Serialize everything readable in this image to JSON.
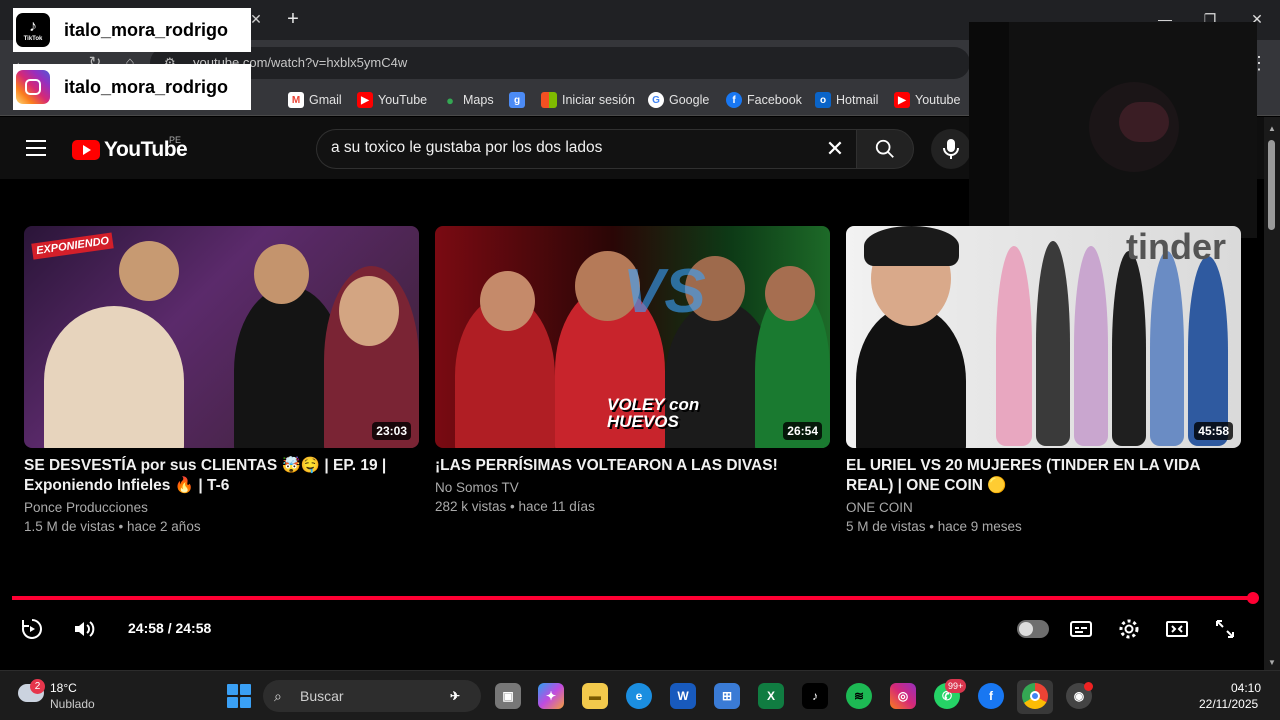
{
  "overlays": {
    "tiktok": {
      "handle": "italo_mora_rodrigo",
      "icon_label": "TikTok"
    },
    "instagram": {
      "handle": "italo_mora_rodrigo"
    }
  },
  "browser": {
    "url": "youtube.com/watch?v=hxblx5ymC4w",
    "bookmarks": [
      {
        "label": "Gmail",
        "icon": "gmail-icon",
        "color": "#ea4335"
      },
      {
        "label": "YouTube",
        "icon": "youtube-icon",
        "color": "#ff0000"
      },
      {
        "label": "Maps",
        "icon": "maps-icon",
        "color": "#34a853"
      },
      {
        "label": "Iniciar sesión",
        "icon": "microsoft-icon",
        "color": "#f25022"
      },
      {
        "label": "Google",
        "icon": "google-icon",
        "color": "#4285f4"
      },
      {
        "label": "Facebook",
        "icon": "facebook-icon",
        "color": "#1877f2"
      },
      {
        "label": "Hotmail",
        "icon": "outlook-icon",
        "color": "#0a64c8"
      },
      {
        "label": "Youtube",
        "icon": "youtube-icon",
        "color": "#ff0000"
      }
    ]
  },
  "youtube": {
    "logo_text": "YouTube",
    "region": "PE",
    "search_query": "a su toxico le gustaba por los dos lados",
    "videos": [
      {
        "title": "SE DESVESTÍA por sus CLIENTAS 🤯🤤 | EP. 19 | Exponiendo Infieles 🔥 | T-6",
        "channel": "Ponce Producciones",
        "meta": "1.5 M de vistas • hace 2 años",
        "duration": "23:03",
        "thumb_text": "EXPONIENDO"
      },
      {
        "title": "¡LAS PERRÍSIMAS VOLTEARON A LAS DIVAS!",
        "channel": "No Somos TV",
        "meta": "282 k vistas • hace 11 días",
        "duration": "26:54",
        "thumb_text": "VOLEY con HUEVOS"
      },
      {
        "title": "EL URIEL VS 20 MUJERES (TINDER EN LA VIDA REAL) | ONE COIN 🟡",
        "channel": "ONE COIN",
        "meta": "5 M de vistas • hace 9 meses",
        "duration": "45:58",
        "thumb_text": "tinder"
      }
    ]
  },
  "player": {
    "time": "24:58 / 24:58",
    "progress": 1.0
  },
  "taskbar": {
    "temperature": "18°C",
    "condition": "Nublado",
    "weather_badge": "2",
    "search_placeholder": "Buscar",
    "whatsapp_badge": "99+",
    "time": "04:10",
    "date": "22/11/2025"
  }
}
